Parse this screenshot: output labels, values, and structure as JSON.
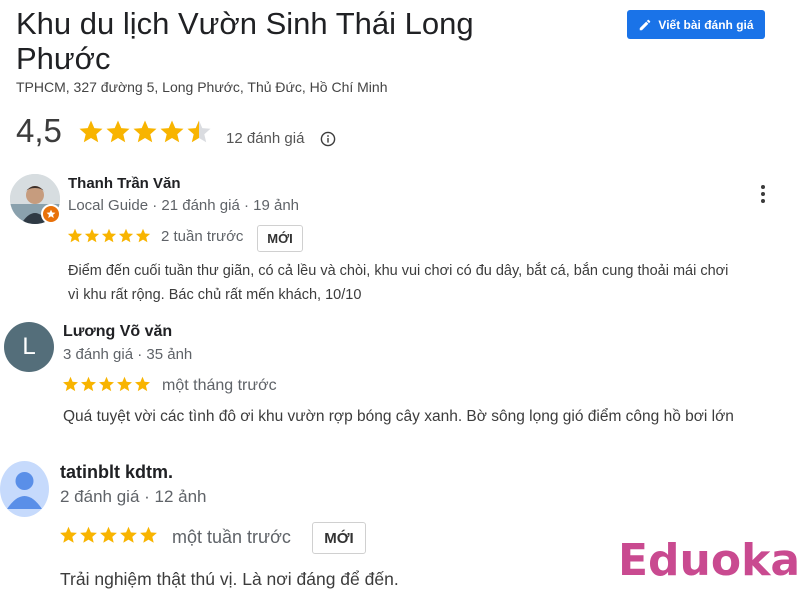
{
  "place": {
    "title": "Khu du lịch Vườn Sinh Thái Long Phước",
    "address": "TPHCM, 327 đường 5, Long Phước, Thủ Đức, Hồ Chí Minh",
    "write_review_label": "Viết bài đánh giá",
    "rating": "4,5",
    "rating_value": 4.5,
    "rating_max": 5,
    "review_count": "12 đánh giá"
  },
  "reviews": [
    {
      "name": "Thanh Trần Văn",
      "meta": "Local Guide · 21 đánh giá · 19 ảnh",
      "stars": 5,
      "date": "2 tuần trước",
      "badge": "MỚI",
      "text_line1": "Điểm đến cuối tuần thư giãn, có cả lều và chòi, khu vui chơi có đu dây, bắt cá, bắn cung thoải mái chơi",
      "text_line2": "vì khu rất rộng. Bác chủ rất mến khách, 10/10"
    },
    {
      "name": "Lương Võ văn",
      "avatar_letter": "L",
      "meta": "3 đánh giá · 35 ảnh",
      "stars": 5,
      "date": "một tháng trước",
      "text_line1": "Quá tuyệt vời các tình đô ơi khu vườn rợp bóng cây xanh. Bờ sông lọng gió điểm công hồ bơi lớn"
    },
    {
      "name": "tatinblt kdtm.",
      "meta": "2 đánh giá · 12 ảnh",
      "stars": 5,
      "date": "một tuần trước",
      "badge": "MỚI",
      "text_line1": "Trải nghiệm thật thú vị. Là nơi đáng để đến."
    }
  ],
  "watermark": {
    "text": "Eduoka"
  },
  "colors": {
    "accent": "#1a73e8",
    "star": "#f8b400",
    "watermark": "#c94a90"
  }
}
